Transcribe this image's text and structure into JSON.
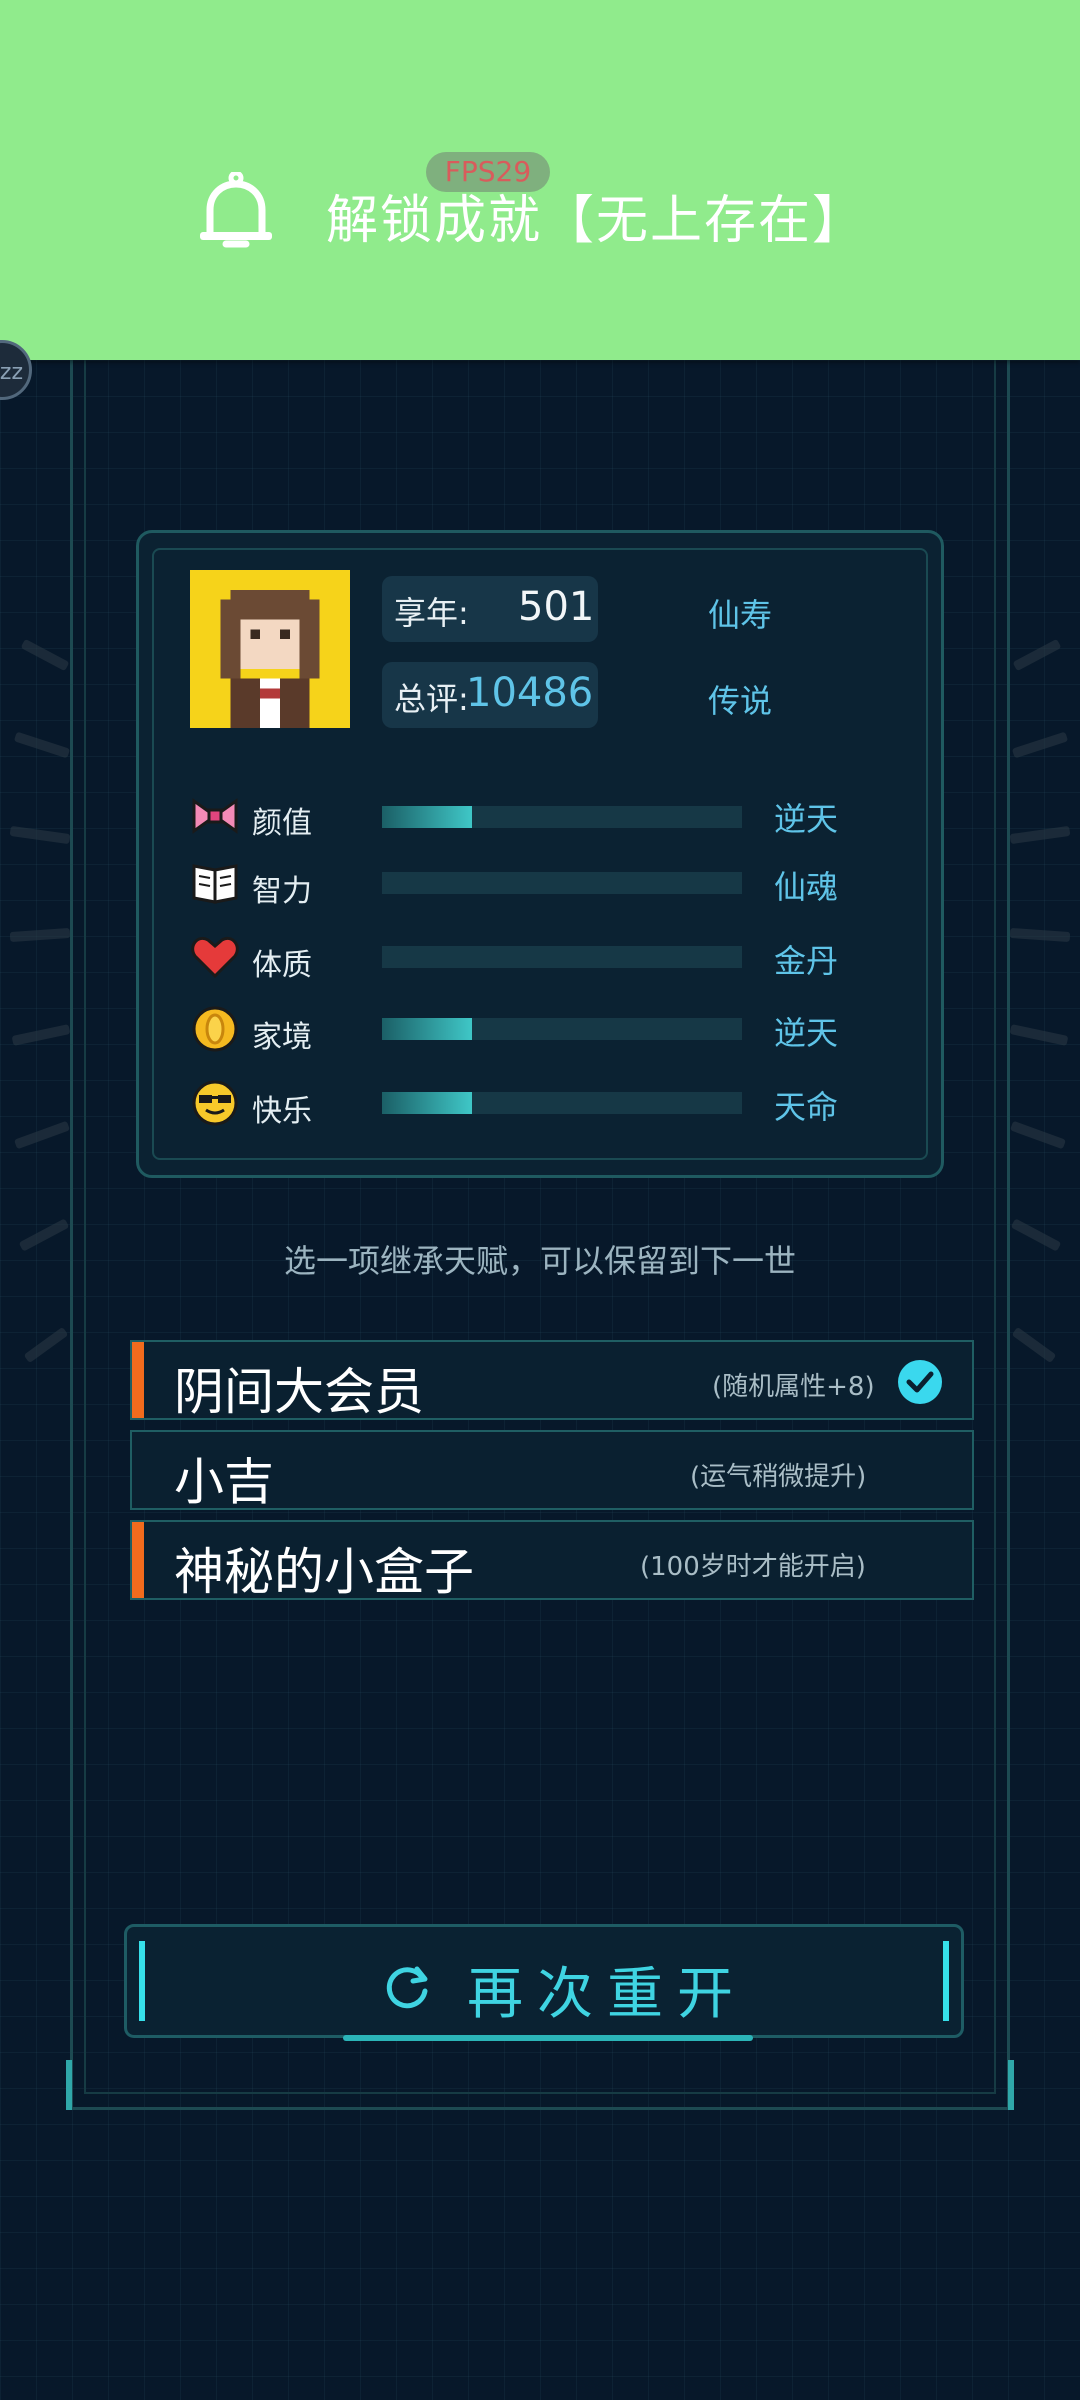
{
  "notification": {
    "fps": "FPS29",
    "icon": "bell-icon",
    "text": "解锁成就【无上存在】"
  },
  "side_bubble": "zz",
  "profile": {
    "avatar": "pixel-character-avatar",
    "age_label": "享年:",
    "age_value": "501",
    "age_grade": "仙寿",
    "score_label": "总评:",
    "score_value": "10486",
    "score_grade": "传说"
  },
  "attributes": [
    {
      "icon": "bow-icon",
      "label": "颜值",
      "level": 0.25,
      "grade": "逆天"
    },
    {
      "icon": "book-icon",
      "label": "智力",
      "level": 0.0,
      "grade": "仙魂"
    },
    {
      "icon": "heart-icon",
      "label": "体质",
      "level": 0.0,
      "grade": "金丹"
    },
    {
      "icon": "coin-icon",
      "label": "家境",
      "level": 0.25,
      "grade": "逆天"
    },
    {
      "icon": "sunglasses-emoji-icon",
      "label": "快乐",
      "level": 0.25,
      "grade": "天命"
    }
  ],
  "hint": "选一项继承天赋，可以保留到下一世",
  "talents": [
    {
      "name": "阴间大会员",
      "desc": "(随机属性+8)",
      "selected": true,
      "accent": true
    },
    {
      "name": "小吉",
      "desc": "(运气稍微提升)",
      "selected": false,
      "accent": false
    },
    {
      "name": "神秘的小盒子",
      "desc": "(100岁时才能开启)",
      "selected": false,
      "accent": true
    }
  ],
  "restart": {
    "label": "再次重开",
    "icon": "refresh-icon"
  },
  "colors": {
    "background": "#07182a",
    "notification": "#90eb8c",
    "accent_cyan": "#3fd4e2",
    "accent_orange": "#f26b1d",
    "grade_blue": "#5fc4e8"
  }
}
